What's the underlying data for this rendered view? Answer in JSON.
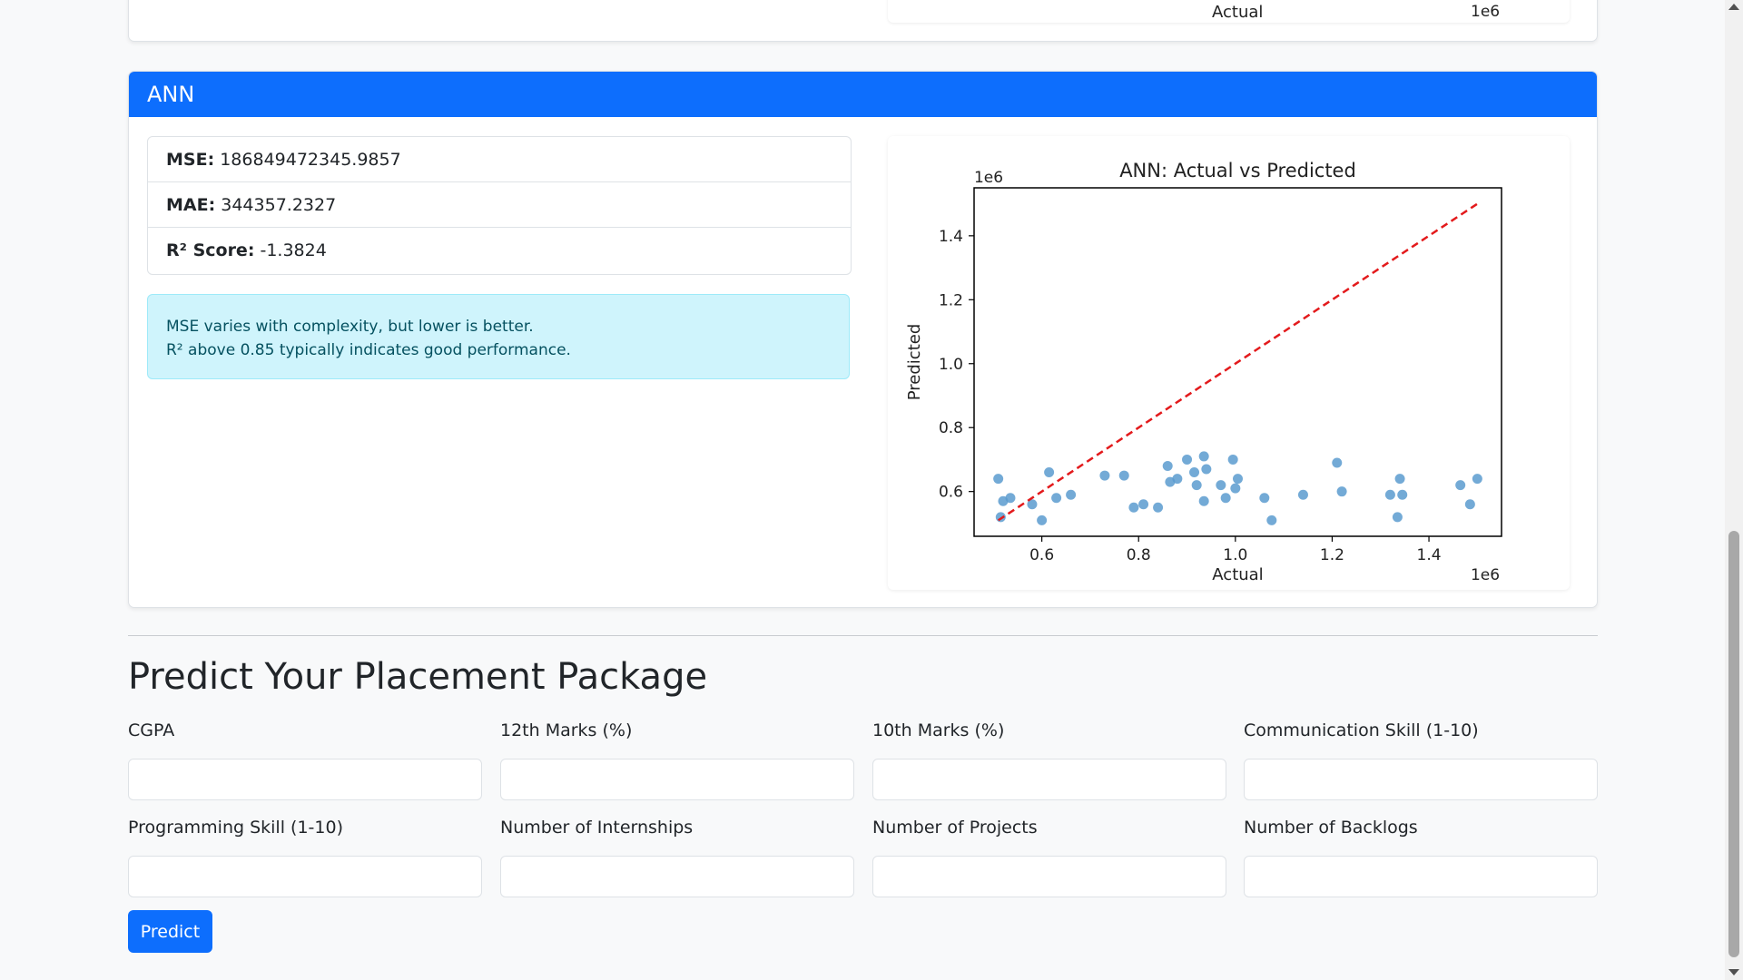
{
  "previous_plot": {
    "xlabel": "Actual",
    "exponent": "1e6"
  },
  "model": {
    "name": "ANN",
    "metrics": [
      {
        "label": "MSE:",
        "value": "186849472345.9857"
      },
      {
        "label": "MAE:",
        "value": "344357.2327"
      },
      {
        "label": "R² Score:",
        "value": "-1.3824"
      }
    ],
    "note_line1": "MSE varies with complexity, but lower is better.",
    "note_line2": "R² above 0.85 typically indicates good performance."
  },
  "chart_data": {
    "type": "scatter",
    "title": "ANN: Actual vs Predicted",
    "xlabel": "Actual",
    "ylabel": "Predicted",
    "x_exponent": "1e6",
    "y_exponent": "1e6",
    "xlim": [
      0.46,
      1.55
    ],
    "ylim": [
      0.46,
      1.55
    ],
    "xticks": [
      0.6,
      0.8,
      1.0,
      1.2,
      1.4
    ],
    "yticks": [
      0.6,
      0.8,
      1.0,
      1.2,
      1.4
    ],
    "point_color": "#5b9bcf",
    "line_color": "#e31a1c",
    "reference_line": {
      "x": [
        0.51,
        1.5
      ],
      "y": [
        0.51,
        1.5
      ]
    },
    "points": [
      [
        0.51,
        0.64
      ],
      [
        0.515,
        0.52
      ],
      [
        0.52,
        0.57
      ],
      [
        0.535,
        0.58
      ],
      [
        0.58,
        0.56
      ],
      [
        0.6,
        0.51
      ],
      [
        0.615,
        0.66
      ],
      [
        0.63,
        0.58
      ],
      [
        0.66,
        0.59
      ],
      [
        0.73,
        0.65
      ],
      [
        0.77,
        0.65
      ],
      [
        0.79,
        0.55
      ],
      [
        0.81,
        0.56
      ],
      [
        0.84,
        0.55
      ],
      [
        0.86,
        0.68
      ],
      [
        0.865,
        0.63
      ],
      [
        0.88,
        0.64
      ],
      [
        0.9,
        0.7
      ],
      [
        0.915,
        0.66
      ],
      [
        0.92,
        0.62
      ],
      [
        0.935,
        0.57
      ],
      [
        0.935,
        0.71
      ],
      [
        0.94,
        0.67
      ],
      [
        0.97,
        0.62
      ],
      [
        0.98,
        0.58
      ],
      [
        0.995,
        0.7
      ],
      [
        1.0,
        0.61
      ],
      [
        1.005,
        0.64
      ],
      [
        1.06,
        0.58
      ],
      [
        1.075,
        0.51
      ],
      [
        1.14,
        0.59
      ],
      [
        1.21,
        0.69
      ],
      [
        1.22,
        0.6
      ],
      [
        1.32,
        0.59
      ],
      [
        1.335,
        0.52
      ],
      [
        1.34,
        0.64
      ],
      [
        1.345,
        0.59
      ],
      [
        1.465,
        0.62
      ],
      [
        1.485,
        0.56
      ],
      [
        1.5,
        0.64
      ]
    ]
  },
  "form": {
    "title": "Predict Your Placement Package",
    "fields": [
      {
        "label": "CGPA",
        "value": ""
      },
      {
        "label": "12th Marks (%)",
        "value": ""
      },
      {
        "label": "10th Marks (%)",
        "value": ""
      },
      {
        "label": "Communication Skill (1-10)",
        "value": ""
      },
      {
        "label": "Programming Skill (1-10)",
        "value": ""
      },
      {
        "label": "Number of Internships",
        "value": ""
      },
      {
        "label": "Number of Projects",
        "value": ""
      },
      {
        "label": "Number of Backlogs",
        "value": ""
      }
    ],
    "submit_label": "Predict"
  }
}
